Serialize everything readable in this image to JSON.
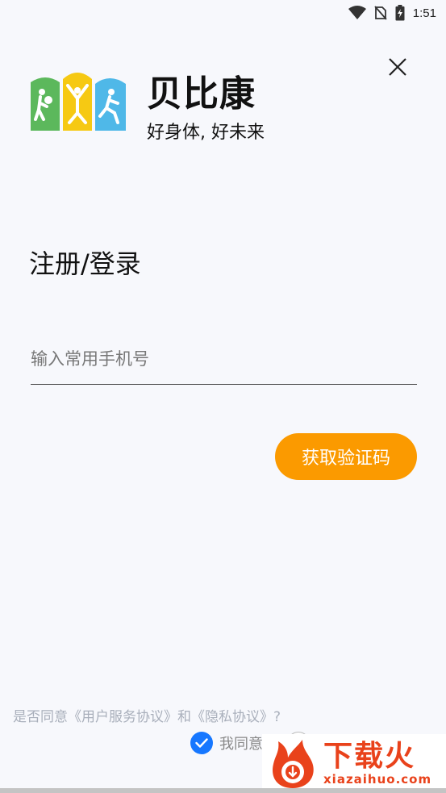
{
  "status_bar": {
    "time": "1:51"
  },
  "brand": {
    "name": "贝比康",
    "slogan": "好身体, 好未来"
  },
  "page": {
    "title": "注册/登录"
  },
  "form": {
    "phone_placeholder": "输入常用手机号",
    "phone_value": "",
    "get_code_label": "获取验证码"
  },
  "agreement": {
    "question": "是否同意《用户服务协议》和《隐私协议》?",
    "agree_label": "我同意",
    "disagree_label": "",
    "agreed": true
  },
  "watermark": {
    "cn": "下载火",
    "en": "xiazaihuo.com"
  },
  "colors": {
    "accent_orange": "#fb9a00",
    "check_blue": "#1677ff",
    "logo_green": "#5cb85c",
    "logo_yellow": "#f6c913",
    "logo_blue": "#4fb8e8",
    "watermark_red": "#e9421b"
  }
}
